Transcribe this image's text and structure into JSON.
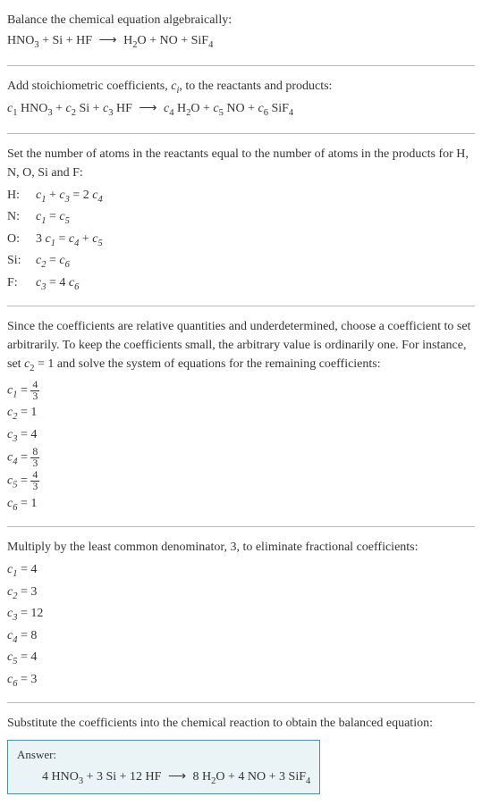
{
  "section1": {
    "title": "Balance the chemical equation algebraically:",
    "equation_parts": {
      "r1": "HNO",
      "r1_sub": "3",
      "r2": "Si",
      "r3": "HF",
      "p1": "H",
      "p1_sub": "2",
      "p1b": "O",
      "p2": "NO",
      "p3": "SiF",
      "p3_sub": "4"
    }
  },
  "section2": {
    "text_before": "Add stoichiometric coefficients, ",
    "ci": "c",
    "ci_sub": "i",
    "text_after": ", to the reactants and products:",
    "c1": "c",
    "c1s": "1",
    "c2": "c",
    "c2s": "2",
    "c3": "c",
    "c3s": "3",
    "c4": "c",
    "c4s": "4",
    "c5": "c",
    "c5s": "5",
    "c6": "c",
    "c6s": "6"
  },
  "section3": {
    "text": "Set the number of atoms in the reactants equal to the number of atoms in the products for H, N, O, Si and F:",
    "atoms": [
      {
        "label": "H:",
        "eq_parts": [
          "c",
          "1",
          " + ",
          "c",
          "3",
          " = 2 ",
          "c",
          "4"
        ]
      },
      {
        "label": "N:",
        "eq_parts": [
          "c",
          "1",
          " = ",
          "c",
          "5"
        ]
      },
      {
        "label": "O:",
        "eq_parts": [
          "3 ",
          "c",
          "1",
          " = ",
          "c",
          "4",
          " + ",
          "c",
          "5"
        ]
      },
      {
        "label": "Si:",
        "eq_parts": [
          "c",
          "2",
          " = ",
          "c",
          "6"
        ]
      },
      {
        "label": "F:",
        "eq_parts": [
          "c",
          "3",
          " = 4 ",
          "c",
          "6"
        ]
      }
    ]
  },
  "section4": {
    "text_p1": "Since the coefficients are relative quantities and underdetermined, choose a coefficient to set arbitrarily. To keep the coefficients small, the arbitrary value is ordinarily one. For instance, set ",
    "c2": "c",
    "c2s": "2",
    "text_p2": " = 1 and solve the system of equations for the remaining coefficients:",
    "coeffs": [
      {
        "var": "c",
        "sub": "1",
        "eq": " = ",
        "frac_num": "4",
        "frac_den": "3"
      },
      {
        "var": "c",
        "sub": "2",
        "eq": " = 1"
      },
      {
        "var": "c",
        "sub": "3",
        "eq": " = 4"
      },
      {
        "var": "c",
        "sub": "4",
        "eq": " = ",
        "frac_num": "8",
        "frac_den": "3"
      },
      {
        "var": "c",
        "sub": "5",
        "eq": " = ",
        "frac_num": "4",
        "frac_den": "3"
      },
      {
        "var": "c",
        "sub": "6",
        "eq": " = 1"
      }
    ]
  },
  "section5": {
    "text": "Multiply by the least common denominator, 3, to eliminate fractional coefficients:",
    "coeffs": [
      {
        "var": "c",
        "sub": "1",
        "val": " = 4"
      },
      {
        "var": "c",
        "sub": "2",
        "val": " = 3"
      },
      {
        "var": "c",
        "sub": "3",
        "val": " = 12"
      },
      {
        "var": "c",
        "sub": "4",
        "val": " = 8"
      },
      {
        "var": "c",
        "sub": "5",
        "val": " = 4"
      },
      {
        "var": "c",
        "sub": "6",
        "val": " = 3"
      }
    ]
  },
  "section6": {
    "text": "Substitute the coefficients into the chemical reaction to obtain the balanced equation:",
    "answer_label": "Answer:",
    "answer": {
      "c1": "4 HNO",
      "s1": "3",
      "c2": " + 3 Si + 12 HF",
      "c3": "8 H",
      "s3": "2",
      "c4": "O + 4 NO + 3 SiF",
      "s4": "4"
    }
  },
  "chart_data": {
    "type": "table",
    "description": "Chemical equation balancing with stoichiometric coefficients",
    "reactants": [
      "HNO3",
      "Si",
      "HF"
    ],
    "products": [
      "H2O",
      "NO",
      "SiF4"
    ],
    "atom_balance": {
      "H": "c1 + c3 = 2*c4",
      "N": "c1 = c5",
      "O": "3*c1 = c4 + c5",
      "Si": "c2 = c6",
      "F": "c3 = 4*c6"
    },
    "solution_c2_eq_1": {
      "c1": "4/3",
      "c2": 1,
      "c3": 4,
      "c4": "8/3",
      "c5": "4/3",
      "c6": 1
    },
    "final_coefficients": {
      "c1": 4,
      "c2": 3,
      "c3": 12,
      "c4": 8,
      "c5": 4,
      "c6": 3
    },
    "balanced_equation": "4 HNO3 + 3 Si + 12 HF → 8 H2O + 4 NO + 3 SiF4"
  }
}
